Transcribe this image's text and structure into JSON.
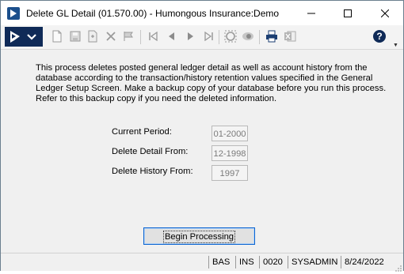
{
  "window": {
    "title": "Delete GL Detail (01.570.00) - Humongous Insurance:Demo"
  },
  "toolbar": {
    "icons": [
      "dynamics-icon",
      "chevron-down-icon",
      "new-icon",
      "save-icon",
      "copy-icon",
      "delete-icon",
      "flag-icon",
      "first-icon",
      "previous-icon",
      "next-icon",
      "last-icon",
      "refresh-icon",
      "view-icon",
      "print-icon",
      "excel-icon",
      "help-icon"
    ],
    "help_label": "?"
  },
  "description": "This process deletes posted general ledger detail as well as account history from the\ndatabase according to the transaction/history retention values specified in the General\nLedger Setup Screen.  Make a backup copy of your database before you run this process.\n Refer to this backup copy if you need the deleted information.",
  "fields": [
    {
      "label": "Current Period:",
      "value": "01-2000"
    },
    {
      "label": "Delete Detail From:",
      "value": "12-1998"
    },
    {
      "label": "Delete History From:",
      "value": "1997"
    }
  ],
  "begin_button": "Begin Processing",
  "statusbar": {
    "mode": "BAS",
    "insert": "INS",
    "company": "0020",
    "user": "SYSADMIN",
    "date": "8/24/2022"
  },
  "colors": {
    "brand": "#0f2a57",
    "focus_border": "#0b64d1"
  }
}
